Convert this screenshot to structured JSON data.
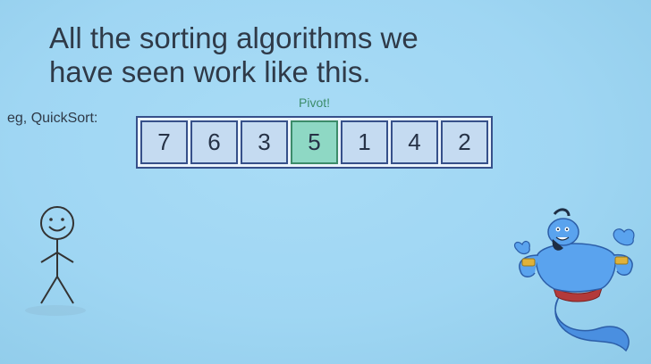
{
  "title": {
    "line1": "All the sorting algorithms we",
    "line2": "have seen work like this."
  },
  "example_label": "eg, QuickSort:",
  "pivot_label": "Pivot!",
  "array": {
    "values": [
      "7",
      "6",
      "3",
      "5",
      "1",
      "4",
      "2"
    ],
    "pivot_index": 3
  },
  "colors": {
    "cell_fill": "#c5dbf1",
    "cell_border": "#36508a",
    "pivot_fill": "#8ed8c4",
    "pivot_text": "#3c8c6a"
  },
  "illustrations": {
    "left": "stick-figure",
    "right": "genie"
  }
}
